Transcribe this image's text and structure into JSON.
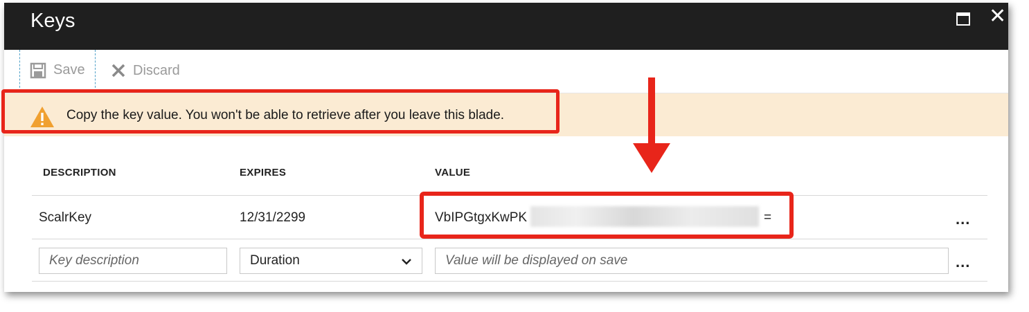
{
  "window": {
    "title": "Keys"
  },
  "toolbar": {
    "save_label": "Save",
    "discard_label": "Discard"
  },
  "banner": {
    "message": "Copy the key value. You won't be able to retrieve after you leave this blade."
  },
  "table": {
    "headers": [
      "DESCRIPTION",
      "EXPIRES",
      "VALUE"
    ],
    "rows": [
      {
        "description": "ScalrKey",
        "expires": "12/31/2299",
        "value_visible": "VbIPGtgxKwPK",
        "value_tail": "=",
        "more": "..."
      }
    ],
    "new_row": {
      "description_placeholder": "Key description",
      "duration_selected": "Duration",
      "value_placeholder": "Value will be displayed on save",
      "more": "..."
    }
  },
  "colors": {
    "highlight": "#e8251a",
    "banner_bg": "#fbebd3",
    "titlebar_bg": "#1f1f1f",
    "warning": "#f0a030"
  },
  "icons": [
    "save-icon",
    "discard-icon",
    "warning-icon",
    "maximize-icon",
    "close-icon",
    "chevron-down-icon",
    "arrow-down-icon"
  ]
}
